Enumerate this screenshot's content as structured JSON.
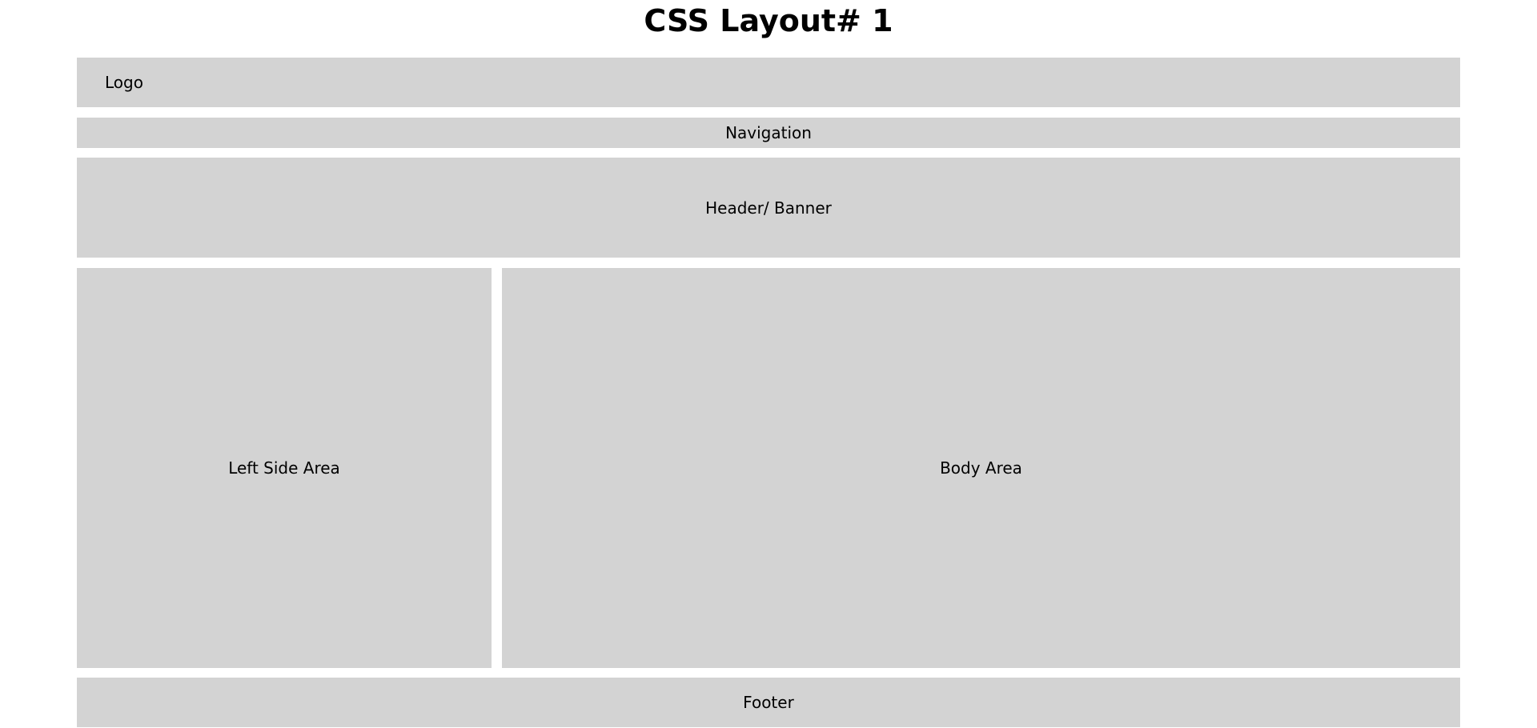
{
  "page": {
    "title": "CSS Layout# 1"
  },
  "sections": {
    "logo": "Logo",
    "navigation": "Navigation",
    "banner": "Header/ Banner",
    "left_side": "Left Side Area",
    "body": "Body Area",
    "footer": "Footer"
  },
  "colors": {
    "block_background": "#d3d3d3",
    "page_background": "#ffffff",
    "text": "#000000"
  }
}
